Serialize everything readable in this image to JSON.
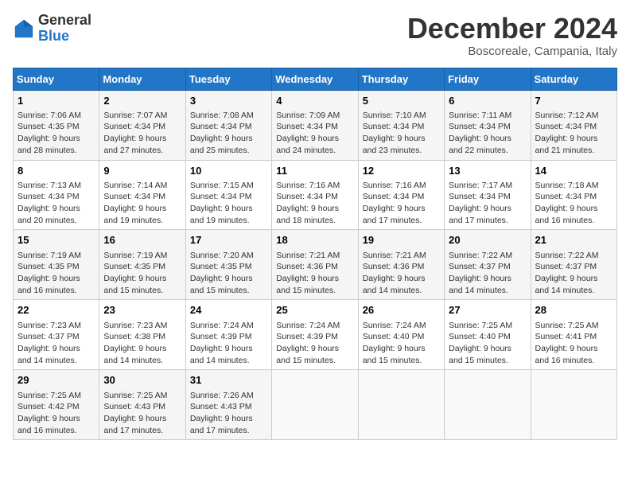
{
  "header": {
    "logo_line1": "General",
    "logo_line2": "Blue",
    "month": "December 2024",
    "location": "Boscoreale, Campania, Italy"
  },
  "weekdays": [
    "Sunday",
    "Monday",
    "Tuesday",
    "Wednesday",
    "Thursday",
    "Friday",
    "Saturday"
  ],
  "weeks": [
    [
      {
        "day": "1",
        "sunrise": "Sunrise: 7:06 AM",
        "sunset": "Sunset: 4:35 PM",
        "daylight": "Daylight: 9 hours and 28 minutes."
      },
      {
        "day": "2",
        "sunrise": "Sunrise: 7:07 AM",
        "sunset": "Sunset: 4:34 PM",
        "daylight": "Daylight: 9 hours and 27 minutes."
      },
      {
        "day": "3",
        "sunrise": "Sunrise: 7:08 AM",
        "sunset": "Sunset: 4:34 PM",
        "daylight": "Daylight: 9 hours and 25 minutes."
      },
      {
        "day": "4",
        "sunrise": "Sunrise: 7:09 AM",
        "sunset": "Sunset: 4:34 PM",
        "daylight": "Daylight: 9 hours and 24 minutes."
      },
      {
        "day": "5",
        "sunrise": "Sunrise: 7:10 AM",
        "sunset": "Sunset: 4:34 PM",
        "daylight": "Daylight: 9 hours and 23 minutes."
      },
      {
        "day": "6",
        "sunrise": "Sunrise: 7:11 AM",
        "sunset": "Sunset: 4:34 PM",
        "daylight": "Daylight: 9 hours and 22 minutes."
      },
      {
        "day": "7",
        "sunrise": "Sunrise: 7:12 AM",
        "sunset": "Sunset: 4:34 PM",
        "daylight": "Daylight: 9 hours and 21 minutes."
      }
    ],
    [
      {
        "day": "8",
        "sunrise": "Sunrise: 7:13 AM",
        "sunset": "Sunset: 4:34 PM",
        "daylight": "Daylight: 9 hours and 20 minutes."
      },
      {
        "day": "9",
        "sunrise": "Sunrise: 7:14 AM",
        "sunset": "Sunset: 4:34 PM",
        "daylight": "Daylight: 9 hours and 19 minutes."
      },
      {
        "day": "10",
        "sunrise": "Sunrise: 7:15 AM",
        "sunset": "Sunset: 4:34 PM",
        "daylight": "Daylight: 9 hours and 19 minutes."
      },
      {
        "day": "11",
        "sunrise": "Sunrise: 7:16 AM",
        "sunset": "Sunset: 4:34 PM",
        "daylight": "Daylight: 9 hours and 18 minutes."
      },
      {
        "day": "12",
        "sunrise": "Sunrise: 7:16 AM",
        "sunset": "Sunset: 4:34 PM",
        "daylight": "Daylight: 9 hours and 17 minutes."
      },
      {
        "day": "13",
        "sunrise": "Sunrise: 7:17 AM",
        "sunset": "Sunset: 4:34 PM",
        "daylight": "Daylight: 9 hours and 17 minutes."
      },
      {
        "day": "14",
        "sunrise": "Sunrise: 7:18 AM",
        "sunset": "Sunset: 4:34 PM",
        "daylight": "Daylight: 9 hours and 16 minutes."
      }
    ],
    [
      {
        "day": "15",
        "sunrise": "Sunrise: 7:19 AM",
        "sunset": "Sunset: 4:35 PM",
        "daylight": "Daylight: 9 hours and 16 minutes."
      },
      {
        "day": "16",
        "sunrise": "Sunrise: 7:19 AM",
        "sunset": "Sunset: 4:35 PM",
        "daylight": "Daylight: 9 hours and 15 minutes."
      },
      {
        "day": "17",
        "sunrise": "Sunrise: 7:20 AM",
        "sunset": "Sunset: 4:35 PM",
        "daylight": "Daylight: 9 hours and 15 minutes."
      },
      {
        "day": "18",
        "sunrise": "Sunrise: 7:21 AM",
        "sunset": "Sunset: 4:36 PM",
        "daylight": "Daylight: 9 hours and 15 minutes."
      },
      {
        "day": "19",
        "sunrise": "Sunrise: 7:21 AM",
        "sunset": "Sunset: 4:36 PM",
        "daylight": "Daylight: 9 hours and 14 minutes."
      },
      {
        "day": "20",
        "sunrise": "Sunrise: 7:22 AM",
        "sunset": "Sunset: 4:37 PM",
        "daylight": "Daylight: 9 hours and 14 minutes."
      },
      {
        "day": "21",
        "sunrise": "Sunrise: 7:22 AM",
        "sunset": "Sunset: 4:37 PM",
        "daylight": "Daylight: 9 hours and 14 minutes."
      }
    ],
    [
      {
        "day": "22",
        "sunrise": "Sunrise: 7:23 AM",
        "sunset": "Sunset: 4:37 PM",
        "daylight": "Daylight: 9 hours and 14 minutes."
      },
      {
        "day": "23",
        "sunrise": "Sunrise: 7:23 AM",
        "sunset": "Sunset: 4:38 PM",
        "daylight": "Daylight: 9 hours and 14 minutes."
      },
      {
        "day": "24",
        "sunrise": "Sunrise: 7:24 AM",
        "sunset": "Sunset: 4:39 PM",
        "daylight": "Daylight: 9 hours and 14 minutes."
      },
      {
        "day": "25",
        "sunrise": "Sunrise: 7:24 AM",
        "sunset": "Sunset: 4:39 PM",
        "daylight": "Daylight: 9 hours and 15 minutes."
      },
      {
        "day": "26",
        "sunrise": "Sunrise: 7:24 AM",
        "sunset": "Sunset: 4:40 PM",
        "daylight": "Daylight: 9 hours and 15 minutes."
      },
      {
        "day": "27",
        "sunrise": "Sunrise: 7:25 AM",
        "sunset": "Sunset: 4:40 PM",
        "daylight": "Daylight: 9 hours and 15 minutes."
      },
      {
        "day": "28",
        "sunrise": "Sunrise: 7:25 AM",
        "sunset": "Sunset: 4:41 PM",
        "daylight": "Daylight: 9 hours and 16 minutes."
      }
    ],
    [
      {
        "day": "29",
        "sunrise": "Sunrise: 7:25 AM",
        "sunset": "Sunset: 4:42 PM",
        "daylight": "Daylight: 9 hours and 16 minutes."
      },
      {
        "day": "30",
        "sunrise": "Sunrise: 7:25 AM",
        "sunset": "Sunset: 4:43 PM",
        "daylight": "Daylight: 9 hours and 17 minutes."
      },
      {
        "day": "31",
        "sunrise": "Sunrise: 7:26 AM",
        "sunset": "Sunset: 4:43 PM",
        "daylight": "Daylight: 9 hours and 17 minutes."
      },
      null,
      null,
      null,
      null
    ]
  ]
}
